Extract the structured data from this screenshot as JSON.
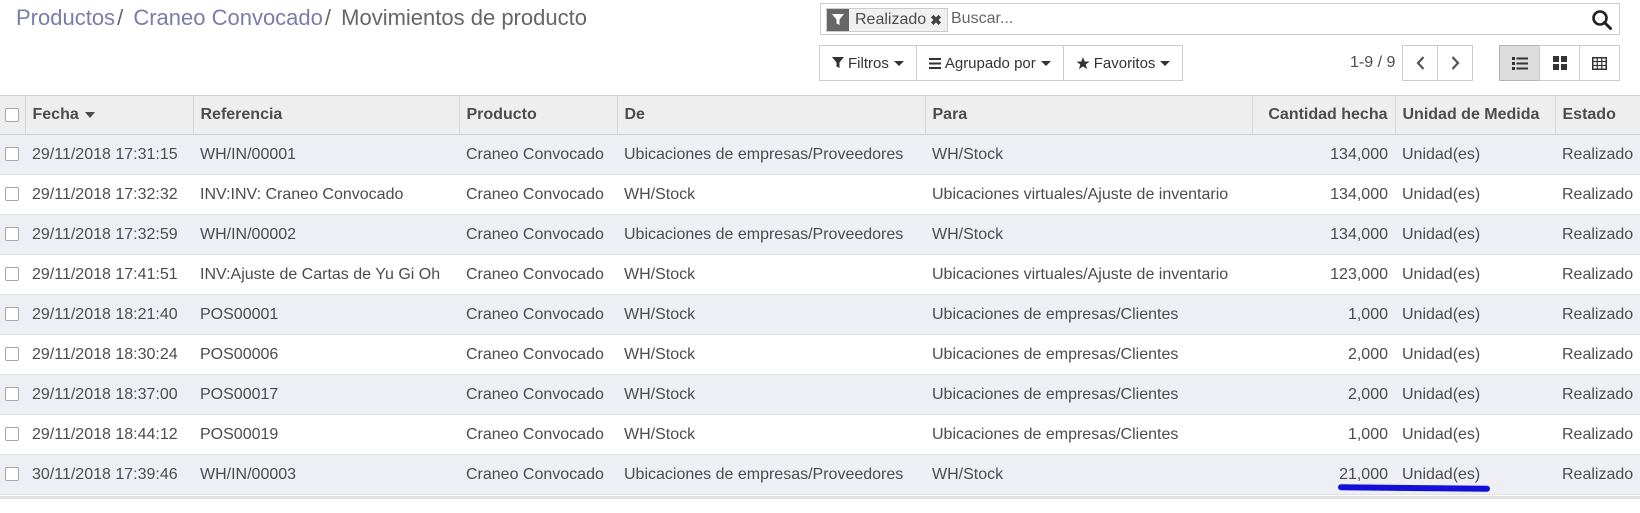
{
  "breadcrumb": {
    "items": [
      "Productos",
      "Craneo Convocado"
    ],
    "separator": "/",
    "current": "Movimientos de producto"
  },
  "search": {
    "facet_value": "Realizado",
    "placeholder": "Buscar..."
  },
  "toolbar": {
    "filters_label": "Filtros",
    "groupby_label": "Agrupado por",
    "favorites_label": "Favoritos"
  },
  "pager": {
    "value": "1-9 / 9"
  },
  "table": {
    "headers": {
      "fecha": "Fecha",
      "referencia": "Referencia",
      "producto": "Producto",
      "de": "De",
      "para": "Para",
      "cantidad": "Cantidad hecha",
      "unidad": "Unidad de Medida",
      "estado": "Estado"
    },
    "rows": [
      {
        "fecha": "29/11/2018 17:31:15",
        "referencia": "WH/IN/00001",
        "producto": "Craneo Convocado",
        "de": "Ubicaciones de empresas/Proveedores",
        "para": "WH/Stock",
        "cantidad": "134,000",
        "unidad": "Unidad(es)",
        "estado": "Realizado"
      },
      {
        "fecha": "29/11/2018 17:32:32",
        "referencia": "INV:INV: Craneo Convocado",
        "producto": "Craneo Convocado",
        "de": "WH/Stock",
        "para": "Ubicaciones virtuales/Ajuste de inventario",
        "cantidad": "134,000",
        "unidad": "Unidad(es)",
        "estado": "Realizado"
      },
      {
        "fecha": "29/11/2018 17:32:59",
        "referencia": "WH/IN/00002",
        "producto": "Craneo Convocado",
        "de": "Ubicaciones de empresas/Proveedores",
        "para": "WH/Stock",
        "cantidad": "134,000",
        "unidad": "Unidad(es)",
        "estado": "Realizado"
      },
      {
        "fecha": "29/11/2018 17:41:51",
        "referencia": "INV:Ajuste de Cartas de Yu Gi Oh",
        "producto": "Craneo Convocado",
        "de": "WH/Stock",
        "para": "Ubicaciones virtuales/Ajuste de inventario",
        "cantidad": "123,000",
        "unidad": "Unidad(es)",
        "estado": "Realizado"
      },
      {
        "fecha": "29/11/2018 18:21:40",
        "referencia": "POS00001",
        "producto": "Craneo Convocado",
        "de": "WH/Stock",
        "para": "Ubicaciones de empresas/Clientes",
        "cantidad": "1,000",
        "unidad": "Unidad(es)",
        "estado": "Realizado"
      },
      {
        "fecha": "29/11/2018 18:30:24",
        "referencia": "POS00006",
        "producto": "Craneo Convocado",
        "de": "WH/Stock",
        "para": "Ubicaciones de empresas/Clientes",
        "cantidad": "2,000",
        "unidad": "Unidad(es)",
        "estado": "Realizado"
      },
      {
        "fecha": "29/11/2018 18:37:00",
        "referencia": "POS00017",
        "producto": "Craneo Convocado",
        "de": "WH/Stock",
        "para": "Ubicaciones de empresas/Clientes",
        "cantidad": "2,000",
        "unidad": "Unidad(es)",
        "estado": "Realizado"
      },
      {
        "fecha": "29/11/2018 18:44:12",
        "referencia": "POS00019",
        "producto": "Craneo Convocado",
        "de": "WH/Stock",
        "para": "Ubicaciones de empresas/Clientes",
        "cantidad": "1,000",
        "unidad": "Unidad(es)",
        "estado": "Realizado"
      },
      {
        "fecha": "30/11/2018 17:39:46",
        "referencia": "WH/IN/00003",
        "producto": "Craneo Convocado",
        "de": "Ubicaciones de empresas/Proveedores",
        "para": "WH/Stock",
        "cantidad": "21,000",
        "unidad": "Unidad(es)",
        "estado": "Realizado"
      }
    ]
  },
  "colors": {
    "breadcrumb_link": "#7c7bad",
    "row_stripe": "#eeeef5",
    "header_bg": "#eeeeee",
    "annotation": "#1010d6"
  },
  "icons": [
    "filter-icon",
    "close-icon",
    "search-icon",
    "bars-icon",
    "star-icon",
    "chevron-left-icon",
    "chevron-right-icon",
    "list-view-icon",
    "kanban-view-icon",
    "grid-view-icon"
  ]
}
